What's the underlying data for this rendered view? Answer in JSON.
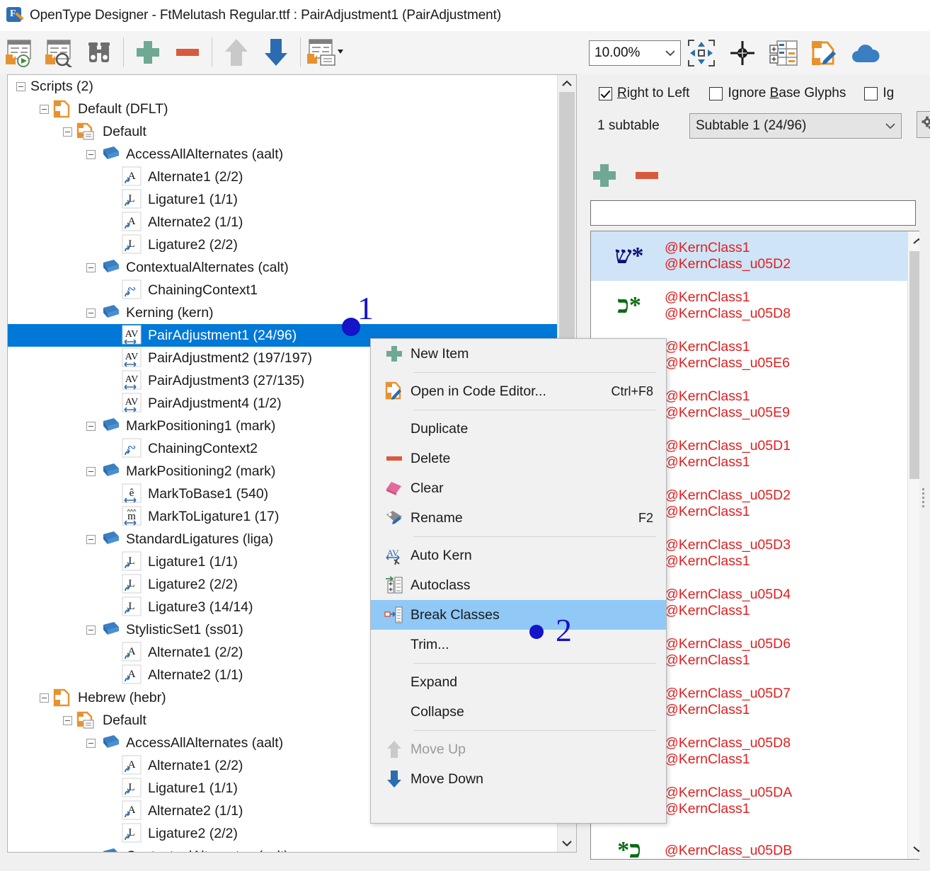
{
  "window": {
    "title": "OpenType Designer - FtMelutash Regular.ttf : PairAdjustment1 (PairAdjustment)",
    "app_icon": "opentype-designer-icon"
  },
  "left_toolbar": {
    "buttons": [
      {
        "name": "compile-and-run-icon",
        "label": "Compile and Run"
      },
      {
        "name": "compile-and-preview-icon",
        "label": "Compile and Preview"
      },
      {
        "name": "find-icon",
        "label": "Find"
      },
      {
        "name": "add-icon",
        "label": "Add"
      },
      {
        "name": "remove-icon",
        "label": "Remove"
      },
      {
        "name": "move-up-icon",
        "label": "Move Up"
      },
      {
        "name": "move-down-icon",
        "label": "Move Down"
      },
      {
        "name": "code-editor-icon",
        "label": "Open in Code Editor"
      }
    ]
  },
  "tree": {
    "rows": [
      {
        "depth": 0,
        "expander": "minus",
        "icon": "none",
        "label": "Scripts (2)"
      },
      {
        "depth": 1,
        "expander": "minus",
        "icon": "script-orange",
        "label": "Default (DFLT)"
      },
      {
        "depth": 2,
        "expander": "minus",
        "icon": "langsys-orange",
        "label": "Default"
      },
      {
        "depth": 3,
        "expander": "minus",
        "icon": "feature-blue",
        "label": "AccessAllAlternates (aalt)"
      },
      {
        "depth": 4,
        "expander": "none",
        "icon": "lookup-A",
        "label": "Alternate1 (2/2)"
      },
      {
        "depth": 4,
        "expander": "none",
        "icon": "lookup-L",
        "label": "Ligature1 (1/1)"
      },
      {
        "depth": 4,
        "expander": "none",
        "icon": "lookup-A",
        "label": "Alternate2 (1/1)"
      },
      {
        "depth": 4,
        "expander": "none",
        "icon": "lookup-L",
        "label": "Ligature2 (2/2)"
      },
      {
        "depth": 3,
        "expander": "minus",
        "icon": "feature-blue",
        "label": "ContextualAlternates (calt)"
      },
      {
        "depth": 4,
        "expander": "none",
        "icon": "lookup-chain",
        "label": "ChainingContext1"
      },
      {
        "depth": 3,
        "expander": "minus",
        "icon": "feature-blue",
        "label": "Kerning (kern)"
      },
      {
        "depth": 4,
        "expander": "none",
        "icon": "lookup-AV",
        "label": "PairAdjustment1 (24/96)",
        "selected": true
      },
      {
        "depth": 4,
        "expander": "none",
        "icon": "lookup-AV",
        "label": "PairAdjustment2 (197/197)"
      },
      {
        "depth": 4,
        "expander": "none",
        "icon": "lookup-AV",
        "label": "PairAdjustment3 (27/135)"
      },
      {
        "depth": 4,
        "expander": "none",
        "icon": "lookup-AV",
        "label": "PairAdjustment4 (1/2)"
      },
      {
        "depth": 3,
        "expander": "minus",
        "icon": "feature-blue",
        "label": "MarkPositioning1 (mark)"
      },
      {
        "depth": 4,
        "expander": "none",
        "icon": "lookup-chain",
        "label": "ChainingContext2"
      },
      {
        "depth": 3,
        "expander": "minus",
        "icon": "feature-blue",
        "label": "MarkPositioning2 (mark)"
      },
      {
        "depth": 4,
        "expander": "none",
        "icon": "lookup-ehat",
        "label": "MarkToBase1 (540)"
      },
      {
        "depth": 4,
        "expander": "none",
        "icon": "lookup-mhat",
        "label": "MarkToLigature1 (17)"
      },
      {
        "depth": 3,
        "expander": "minus",
        "icon": "feature-blue",
        "label": "StandardLigatures (liga)"
      },
      {
        "depth": 4,
        "expander": "none",
        "icon": "lookup-L",
        "label": "Ligature1 (1/1)"
      },
      {
        "depth": 4,
        "expander": "none",
        "icon": "lookup-L",
        "label": "Ligature2 (2/2)"
      },
      {
        "depth": 4,
        "expander": "none",
        "icon": "lookup-L",
        "label": "Ligature3 (14/14)"
      },
      {
        "depth": 3,
        "expander": "minus",
        "icon": "feature-blue",
        "label": "StylisticSet1 (ss01)"
      },
      {
        "depth": 4,
        "expander": "none",
        "icon": "lookup-A",
        "label": "Alternate1 (2/2)"
      },
      {
        "depth": 4,
        "expander": "none",
        "icon": "lookup-A",
        "label": "Alternate2 (1/1)"
      },
      {
        "depth": 1,
        "expander": "minus",
        "icon": "script-orange",
        "label": "Hebrew (hebr)"
      },
      {
        "depth": 2,
        "expander": "minus",
        "icon": "langsys-orange",
        "label": "Default"
      },
      {
        "depth": 3,
        "expander": "minus",
        "icon": "feature-blue",
        "label": "AccessAllAlternates (aalt)"
      },
      {
        "depth": 4,
        "expander": "none",
        "icon": "lookup-A",
        "label": "Alternate1 (2/2)"
      },
      {
        "depth": 4,
        "expander": "none",
        "icon": "lookup-L",
        "label": "Ligature1 (1/1)"
      },
      {
        "depth": 4,
        "expander": "none",
        "icon": "lookup-A",
        "label": "Alternate2 (1/1)"
      },
      {
        "depth": 4,
        "expander": "none",
        "icon": "lookup-L",
        "label": "Ligature2 (2/2)"
      },
      {
        "depth": 3,
        "expander": "minus",
        "icon": "feature-blue",
        "label": "ContextualAlternates (calt)"
      }
    ]
  },
  "context_menu": {
    "items": [
      {
        "kind": "item",
        "icon": "add-icon",
        "label": "New Item",
        "accel": ""
      },
      {
        "kind": "sep"
      },
      {
        "kind": "item",
        "icon": "code-editor-icon",
        "label": "Open in Code Editor...",
        "accel": "Ctrl+F8"
      },
      {
        "kind": "sep"
      },
      {
        "kind": "item",
        "icon": "none",
        "label": "Duplicate",
        "accel": ""
      },
      {
        "kind": "item",
        "icon": "remove-icon",
        "label": "Delete",
        "accel": ""
      },
      {
        "kind": "item",
        "icon": "eraser-icon",
        "label": "Clear",
        "accel": ""
      },
      {
        "kind": "item",
        "icon": "rename-tag-icon",
        "label": "Rename",
        "accel": "F2"
      },
      {
        "kind": "sep"
      },
      {
        "kind": "item",
        "icon": "auto-kern-icon",
        "label": "Auto Kern",
        "accel": ""
      },
      {
        "kind": "item",
        "icon": "autoclass-icon",
        "label": "Autoclass",
        "accel": ""
      },
      {
        "kind": "item",
        "icon": "break-classes-icon",
        "label": "Break Classes",
        "accel": "",
        "highlighted": true
      },
      {
        "kind": "item",
        "icon": "none",
        "label": "Trim...",
        "accel": ""
      },
      {
        "kind": "sep"
      },
      {
        "kind": "item",
        "icon": "none",
        "label": "Expand",
        "accel": ""
      },
      {
        "kind": "item",
        "icon": "none",
        "label": "Collapse",
        "accel": ""
      },
      {
        "kind": "sep"
      },
      {
        "kind": "item",
        "icon": "move-up-icon",
        "label": "Move Up",
        "accel": "",
        "disabled": true
      },
      {
        "kind": "item",
        "icon": "move-down-icon",
        "label": "Move Down",
        "accel": ""
      }
    ]
  },
  "right_panel": {
    "zoom_value": "10.00%",
    "toolbar_buttons": [
      {
        "name": "fit-to-window-icon",
        "label": "Fit to Window"
      },
      {
        "name": "center-origin-icon",
        "label": "Center Origin"
      },
      {
        "name": "class-table-icon",
        "label": "Class Table"
      },
      {
        "name": "code-editor-icon",
        "label": "Open in Code Editor"
      },
      {
        "name": "cloud-icon",
        "label": "Cloud"
      }
    ],
    "checkboxes": [
      {
        "label": "Right to Left",
        "mnemonic": "R",
        "checked": true
      },
      {
        "label": "Ignore Base Glyphs",
        "mnemonic": "B",
        "checked": false
      },
      {
        "label": "Ig",
        "mnemonic": "",
        "checked": false
      }
    ],
    "subtable_count_label": "1 subtable",
    "subtable_selected": "Subtable 1 (24/96)",
    "gear_button": "subtable-settings-icon",
    "add_label": "Add",
    "remove_label": "Remove",
    "filter_value": "",
    "filter_placeholder": ""
  },
  "kern_list": {
    "rows": [
      {
        "glyph": "ש*",
        "glyph_color": "#10107a",
        "first": "@KernClass1",
        "second": "@KernClass_u05D2",
        "selected": true
      },
      {
        "glyph": "כ*",
        "glyph_color": "#0a6b14",
        "first": "@KernClass1",
        "second": "@KernClass_u05D8"
      },
      {
        "glyph": "",
        "glyph_color": "#0a6b14",
        "first": "@KernClass1",
        "second": "@KernClass_u05E6"
      },
      {
        "glyph": "",
        "glyph_color": "#0a6b14",
        "first": "@KernClass1",
        "second": "@KernClass_u05E9"
      },
      {
        "glyph": "",
        "glyph_color": "#0a6b14",
        "first": "@KernClass_u05D1",
        "second": "@KernClass1"
      },
      {
        "glyph": "",
        "glyph_color": "#0a6b14",
        "first": "@KernClass_u05D2",
        "second": "@KernClass1"
      },
      {
        "glyph": "",
        "glyph_color": "#0a6b14",
        "first": "@KernClass_u05D3",
        "second": "@KernClass1"
      },
      {
        "glyph": "",
        "glyph_color": "#0a6b14",
        "first": "@KernClass_u05D4",
        "second": "@KernClass1"
      },
      {
        "glyph": "",
        "glyph_color": "#0a6b14",
        "first": "@KernClass_u05D6",
        "second": "@KernClass1"
      },
      {
        "glyph": "",
        "glyph_color": "#0a6b14",
        "first": "@KernClass_u05D7",
        "second": "@KernClass1"
      },
      {
        "glyph": "",
        "glyph_color": "#0a6b14",
        "first": "@KernClass_u05D8",
        "second": "@KernClass1"
      },
      {
        "glyph": "",
        "glyph_color": "#0a6b14",
        "first": "@KernClass_u05DA",
        "second": "@KernClass1"
      },
      {
        "glyph": "*כ",
        "glyph_color": "#0a6b14",
        "first": "@KernClass_u05DB",
        "second": ""
      }
    ]
  },
  "annotations": [
    {
      "id": "marker-1",
      "text": "1"
    },
    {
      "id": "marker-2",
      "text": "2"
    }
  ],
  "colors": {
    "selection_blue": "#0078d7",
    "menu_highlight": "#90c8f6",
    "list_highlight": "#cfe4f7",
    "kern_text_red": "#e02020",
    "accent_orange": "#e8922f",
    "accent_green": "#6fa893",
    "accent_red": "#d9593c",
    "annotation_blue": "#1414c8"
  }
}
